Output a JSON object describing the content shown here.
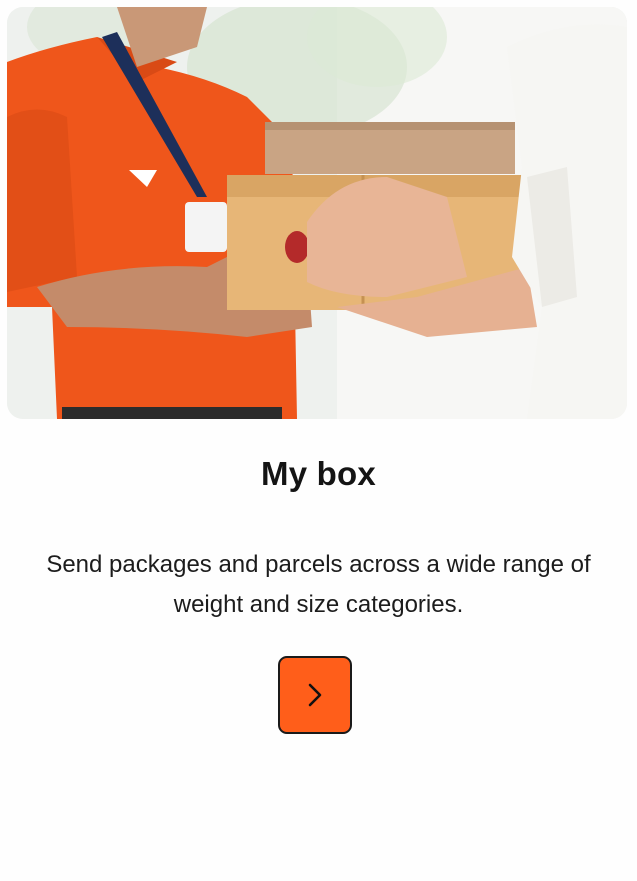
{
  "card": {
    "title": "My box",
    "description": "Send packages and parcels across a wide range of weight and size categories."
  },
  "hero": {
    "image_subject": "courier handing parcel boxes to customer"
  },
  "action": {
    "icon": "chevron-right-icon"
  },
  "colors": {
    "accent": "#FF5E1A",
    "text": "#141414",
    "uniform": "#F0561A"
  }
}
